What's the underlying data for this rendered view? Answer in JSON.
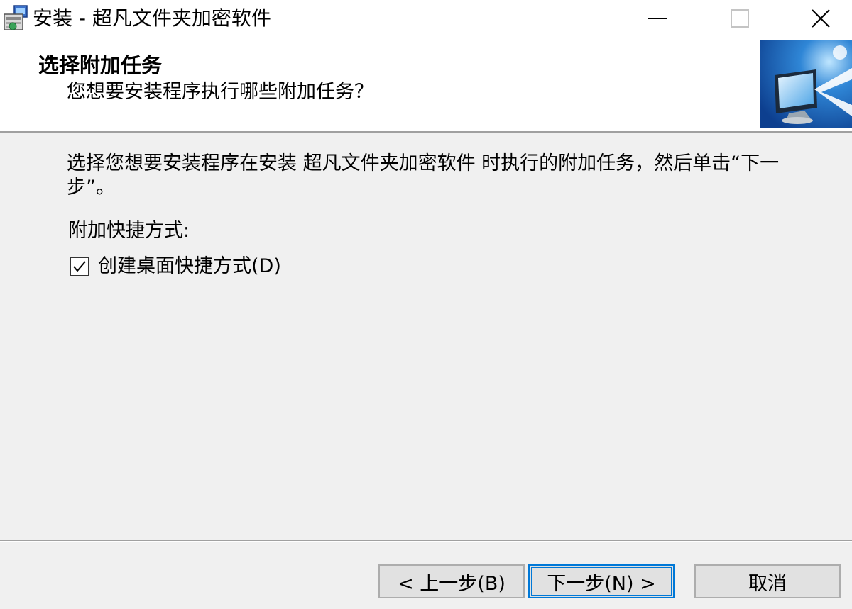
{
  "window": {
    "title": "安装 - 超凡文件夹加密软件",
    "icon": "installer-icon",
    "controls": {
      "minimize_icon": "minimize-icon",
      "maximize_icon": "maximize-icon",
      "close_icon": "close-icon"
    }
  },
  "header": {
    "title": "选择附加任务",
    "subtitle": "您想要安装程序执行哪些附加任务？",
    "image": "monitor-install-graphic"
  },
  "main": {
    "intro": "选择您想要安装程序在安装 超凡文件夹加密软件 时执行的附加任务，然后单击“下一步”。",
    "group_label": "附加快捷方式:",
    "tasks": [
      {
        "label": "创建桌面快捷方式(D)",
        "checked": true
      }
    ]
  },
  "footer": {
    "back_label": "< 上一步(B)",
    "next_label": "下一步(N) >",
    "cancel_label": "取消"
  },
  "colors": {
    "focus_border": "#0078d7",
    "button_face": "#e1e1e1",
    "dialog_bg": "#f0f0f0"
  }
}
